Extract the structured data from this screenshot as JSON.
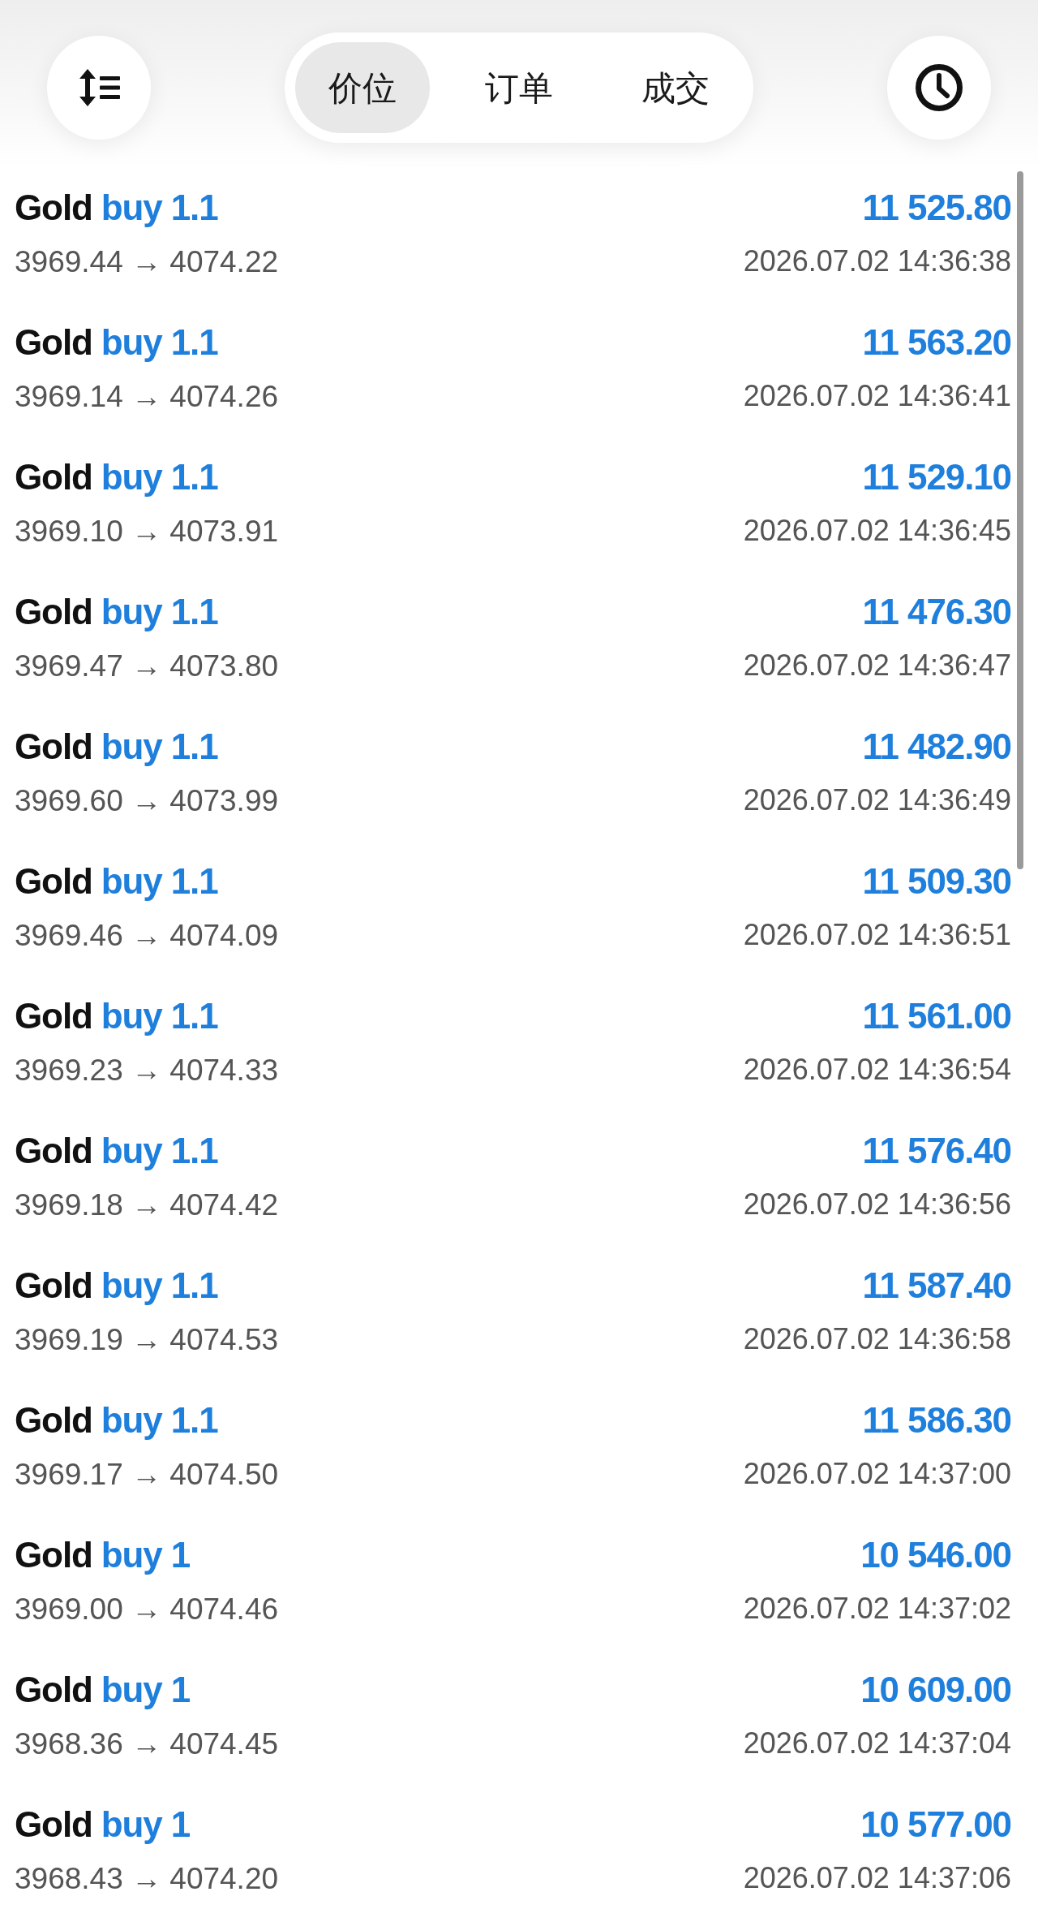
{
  "toolbar": {
    "tabs": [
      {
        "label": "价位",
        "selected": true
      },
      {
        "label": "订单",
        "selected": false
      },
      {
        "label": "成交",
        "selected": false
      }
    ]
  },
  "deals": [
    {
      "symbol": "Gold",
      "side": "buy",
      "volume": "1.1",
      "prices": "3969.44 → 4074.22",
      "profit": "11 525.80",
      "time": "2026.07.02 14:36:38"
    },
    {
      "symbol": "Gold",
      "side": "buy",
      "volume": "1.1",
      "prices": "3969.14 → 4074.26",
      "profit": "11 563.20",
      "time": "2026.07.02 14:36:41"
    },
    {
      "symbol": "Gold",
      "side": "buy",
      "volume": "1.1",
      "prices": "3969.10 → 4073.91",
      "profit": "11 529.10",
      "time": "2026.07.02 14:36:45"
    },
    {
      "symbol": "Gold",
      "side": "buy",
      "volume": "1.1",
      "prices": "3969.47 → 4073.80",
      "profit": "11 476.30",
      "time": "2026.07.02 14:36:47"
    },
    {
      "symbol": "Gold",
      "side": "buy",
      "volume": "1.1",
      "prices": "3969.60 → 4073.99",
      "profit": "11 482.90",
      "time": "2026.07.02 14:36:49"
    },
    {
      "symbol": "Gold",
      "side": "buy",
      "volume": "1.1",
      "prices": "3969.46 → 4074.09",
      "profit": "11 509.30",
      "time": "2026.07.02 14:36:51"
    },
    {
      "symbol": "Gold",
      "side": "buy",
      "volume": "1.1",
      "prices": "3969.23 → 4074.33",
      "profit": "11 561.00",
      "time": "2026.07.02 14:36:54"
    },
    {
      "symbol": "Gold",
      "side": "buy",
      "volume": "1.1",
      "prices": "3969.18 → 4074.42",
      "profit": "11 576.40",
      "time": "2026.07.02 14:36:56"
    },
    {
      "symbol": "Gold",
      "side": "buy",
      "volume": "1.1",
      "prices": "3969.19 → 4074.53",
      "profit": "11 587.40",
      "time": "2026.07.02 14:36:58"
    },
    {
      "symbol": "Gold",
      "side": "buy",
      "volume": "1.1",
      "prices": "3969.17 → 4074.50",
      "profit": "11 586.30",
      "time": "2026.07.02 14:37:00"
    },
    {
      "symbol": "Gold",
      "side": "buy",
      "volume": "1",
      "prices": "3969.00 → 4074.46",
      "profit": "10 546.00",
      "time": "2026.07.02 14:37:02"
    },
    {
      "symbol": "Gold",
      "side": "buy",
      "volume": "1",
      "prices": "3968.36 → 4074.45",
      "profit": "10 609.00",
      "time": "2026.07.02 14:37:04"
    },
    {
      "symbol": "Gold",
      "side": "buy",
      "volume": "1",
      "prices": "3968.43 → 4074.20",
      "profit": "10 577.00",
      "time": "2026.07.02 14:37:06"
    }
  ]
}
